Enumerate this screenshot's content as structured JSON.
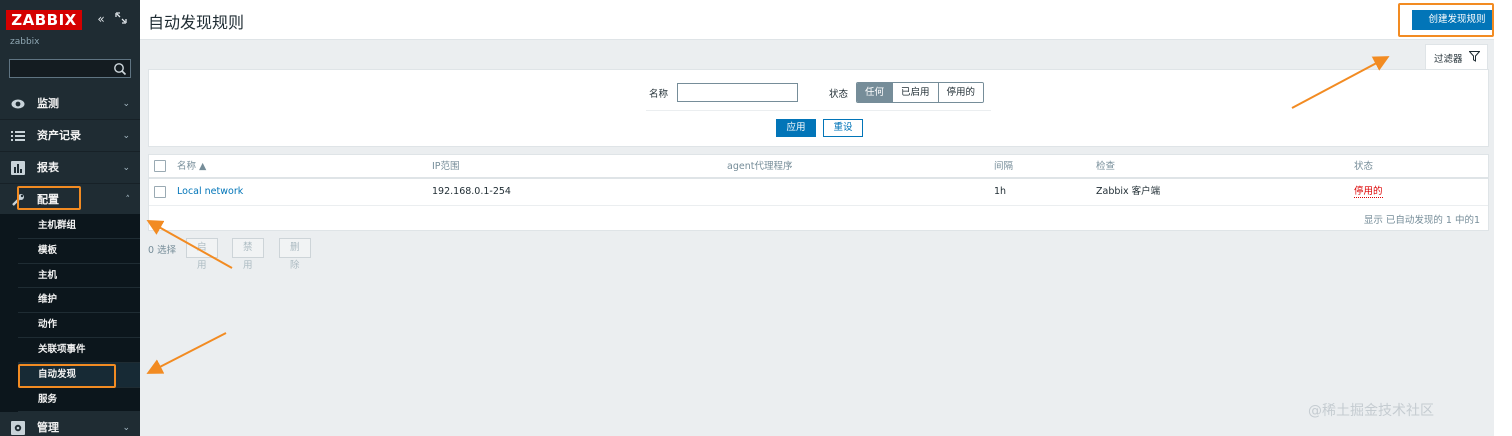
{
  "sidebar": {
    "logo": "ZABBIX",
    "server_name": "zabbix",
    "search_placeholder": "",
    "menu": [
      {
        "label": "监测"
      },
      {
        "label": "资产记录"
      },
      {
        "label": "报表"
      },
      {
        "label": "配置"
      },
      {
        "label": "管理"
      }
    ],
    "config_submenu": [
      {
        "label": "主机群组"
      },
      {
        "label": "模板"
      },
      {
        "label": "主机"
      },
      {
        "label": "维护"
      },
      {
        "label": "动作"
      },
      {
        "label": "关联项事件"
      },
      {
        "label": "自动发现"
      },
      {
        "label": "服务"
      }
    ]
  },
  "header": {
    "title": "自动发现规则",
    "create_button": "创建发现规则"
  },
  "filter": {
    "tab_label": "过滤器",
    "name_label": "名称",
    "name_value": "",
    "status_label": "状态",
    "status_options": [
      "任何",
      "已启用",
      "停用的"
    ],
    "status_selected": "任何",
    "apply_label": "应用",
    "reset_label": "重设"
  },
  "table": {
    "columns": [
      "名称 ▲",
      "IP范围",
      "agent代理程序",
      "间隔",
      "检查",
      "状态"
    ],
    "rows": [
      {
        "name": "Local network",
        "ip_range": "192.168.0.1-254",
        "proxy": "",
        "interval": "1h",
        "checks": "Zabbix 客户端",
        "status": "停用的"
      }
    ],
    "summary": "显示 已自动发现的 1 中的1"
  },
  "bulk": {
    "selected": "0 选择",
    "enable_label": "启用",
    "disable_label": "禁用",
    "delete_label": "删除"
  },
  "watermark": "@稀土掘金技术社区",
  "colors": {
    "sidebar_bg": "#1f2c33",
    "accent_blue": "#0275b8",
    "logo_red": "#d40000",
    "highlight_orange": "#f28b22",
    "disabled_red": "#dc0000"
  }
}
